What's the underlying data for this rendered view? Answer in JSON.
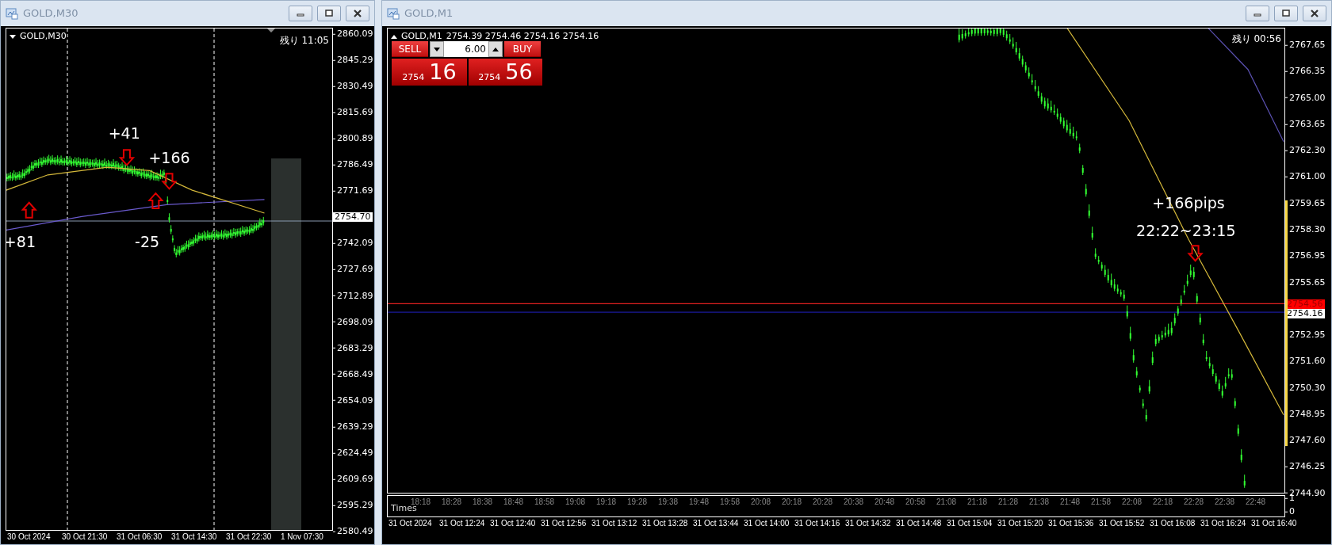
{
  "left_window": {
    "title": "GOLD,M30",
    "chart": {
      "symbol": "GOLD,M30",
      "remaining": "残り 11:05",
      "price_axis": [
        {
          "kind": "tick",
          "text": "2860.09"
        },
        {
          "kind": "tick",
          "text": "2845.29"
        },
        {
          "kind": "tick",
          "text": "2830.49"
        },
        {
          "kind": "tick",
          "text": "2815.69"
        },
        {
          "kind": "tick",
          "text": "2800.89"
        },
        {
          "kind": "tick",
          "text": "2786.49"
        },
        {
          "kind": "tick",
          "text": "2771.69"
        },
        {
          "kind": "markers",
          "labels": [
            {
              "kind": "bid",
              "text": "2754.70"
            }
          ]
        },
        {
          "kind": "tick",
          "text": "2742.09"
        },
        {
          "kind": "tick",
          "text": "2727.69"
        },
        {
          "kind": "tick",
          "text": "2712.89"
        },
        {
          "kind": "tick",
          "text": "2698.09"
        },
        {
          "kind": "tick",
          "text": "2683.29"
        },
        {
          "kind": "tick",
          "text": "2668.49"
        },
        {
          "kind": "tick",
          "text": "2654.09"
        },
        {
          "kind": "tick",
          "text": "2639.29"
        },
        {
          "kind": "tick",
          "text": "2624.49"
        },
        {
          "kind": "tick",
          "text": "2609.69"
        },
        {
          "kind": "tick",
          "text": "2595.29"
        },
        {
          "kind": "tick",
          "text": "2580.49"
        }
      ],
      "time_axis": [
        "30 Oct 2024",
        "30 Oct 21:30",
        "31 Oct 06:30",
        "31 Oct 14:30",
        "31 Oct 22:30",
        "1 Nov 07:30"
      ],
      "annotations": [
        "+41",
        "+166",
        "+81",
        "-25"
      ]
    }
  },
  "right_window": {
    "title": "GOLD,M1",
    "chart": {
      "symbol": "GOLD,M1",
      "quote": "2754.39 2754.46 2754.16 2754.16",
      "remaining": "残り 00:56",
      "trade_panel": {
        "sell_label": "SELL",
        "lot": "6.00",
        "buy_label": "BUY",
        "sell_price": {
          "head": "2754",
          "tail": "16"
        },
        "buy_price": {
          "head": "2754",
          "tail": "56"
        }
      },
      "price_axis": [
        {
          "kind": "tick",
          "text": "2767.65"
        },
        {
          "kind": "tick",
          "text": "2766.35"
        },
        {
          "kind": "tick",
          "text": "2765.00"
        },
        {
          "kind": "tick",
          "text": "2763.65"
        },
        {
          "kind": "tick",
          "text": "2762.30"
        },
        {
          "kind": "tick",
          "text": "2761.00"
        },
        {
          "kind": "tick",
          "text": "2759.65"
        },
        {
          "kind": "tick",
          "text": "2758.30"
        },
        {
          "kind": "tick",
          "text": "2756.95"
        },
        {
          "kind": "tick",
          "text": "2755.65"
        },
        {
          "kind": "markers",
          "labels": [
            {
              "kind": "ask",
              "text": "2754.56"
            },
            {
              "kind": "bid",
              "text": "2754.16"
            }
          ]
        },
        {
          "kind": "tick",
          "text": "2752.95"
        },
        {
          "kind": "tick",
          "text": "2751.60"
        },
        {
          "kind": "tick",
          "text": "2750.30"
        },
        {
          "kind": "tick",
          "text": "2748.95"
        },
        {
          "kind": "tick",
          "text": "2747.60"
        },
        {
          "kind": "tick",
          "text": "2746.25"
        },
        {
          "kind": "tick",
          "text": "2744.90"
        }
      ],
      "annotations": [
        "+166pips",
        "22:22~23:15"
      ],
      "subwindow": {
        "name": "Times",
        "scale": [
          "1",
          "0"
        ],
        "labels": [
          "18:18",
          "18:28",
          "18:38",
          "18:48",
          "18:58",
          "19:08",
          "19:18",
          "19:28",
          "19:38",
          "19:48",
          "19:58",
          "20:08",
          "20:18",
          "20:28",
          "20:38",
          "20:48",
          "20:58",
          "21:08",
          "21:18",
          "21:28",
          "21:38",
          "21:48",
          "21:58",
          "22:08",
          "22:18",
          "22:28",
          "22:38",
          "22:48"
        ]
      },
      "time_axis": [
        "31 Oct 2024",
        "31 Oct 12:24",
        "31 Oct 12:40",
        "31 Oct 12:56",
        "31 Oct 13:12",
        "31 Oct 13:28",
        "31 Oct 13:44",
        "31 Oct 14:00",
        "31 Oct 14:16",
        "31 Oct 14:32",
        "31 Oct 14:48",
        "31 Oct 15:04",
        "31 Oct 15:20",
        "31 Oct 15:36",
        "31 Oct 15:52",
        "31 Oct 16:08",
        "31 Oct 16:24",
        "31 Oct 16:40"
      ]
    }
  }
}
